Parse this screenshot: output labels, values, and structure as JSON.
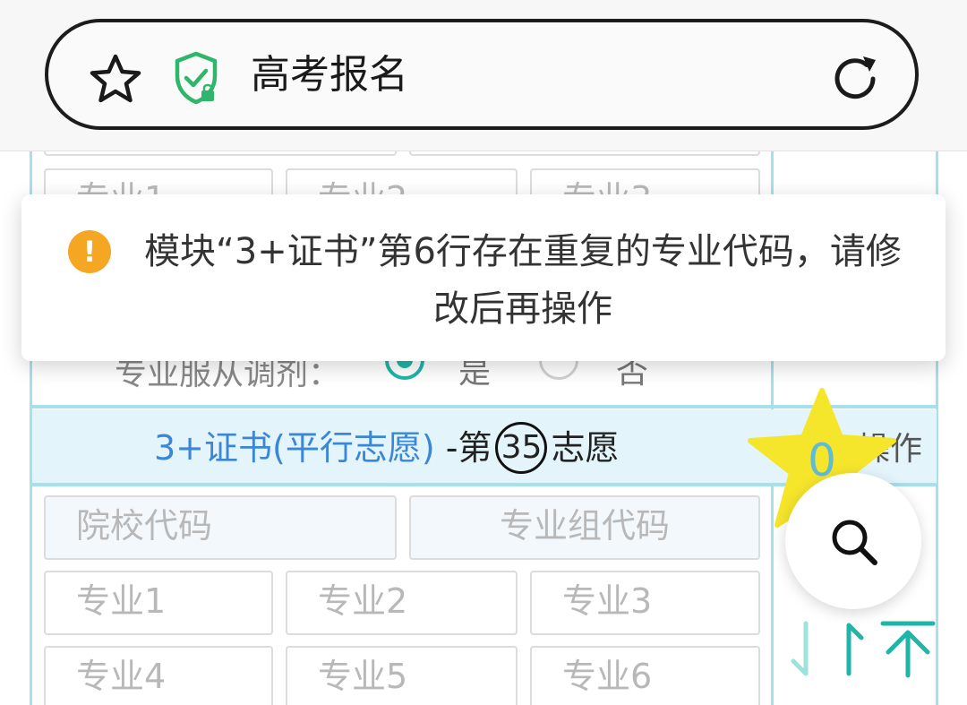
{
  "browser": {
    "page_title": "高考报名",
    "star_icon": "star-outline-icon",
    "shield_icon": "secure-shield-icon",
    "reload_icon": "reload-icon"
  },
  "form": {
    "top_fields": [
      "专业1",
      "专业2",
      "专业3"
    ],
    "adjust_label": "专业服从调剂：",
    "adjust_yes": "是",
    "adjust_no": "否",
    "section": {
      "title_blue": "3+证书(平行志愿)",
      "title_sep": " -第",
      "number": "35",
      "title_suffix": "志愿",
      "side_label": "操作"
    },
    "school_code_placeholder": "院校代码",
    "group_code_placeholder": "专业组代码",
    "major_placeholders": [
      "专业1",
      "专业2",
      "专业3",
      "专业4",
      "专业5",
      "专业6"
    ]
  },
  "toast": {
    "icon": "warning-icon",
    "icon_glyph": "!",
    "message": "模块“3+证书”第6行存在重复的专业代码，请修改后再操作"
  },
  "widgets": {
    "favorite_count": "0",
    "search_icon": "search-icon",
    "scroll_icons": [
      "scroll-down-icon",
      "scroll-up-icon",
      "scroll-top-icon"
    ]
  },
  "colors": {
    "accent_blue": "#3b86d6",
    "teal": "#1fb5a8",
    "grid_line": "#a4e1ea",
    "warning": "#f5a623",
    "favorite_star": "#f5e52b"
  }
}
